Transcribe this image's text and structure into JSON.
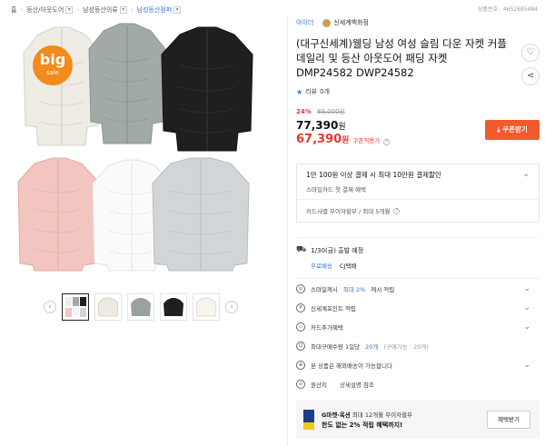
{
  "breadcrumbs": [
    "홈",
    "등산/아웃도어",
    "남성등산의류",
    "남성등산점퍼"
  ],
  "product_code": "상품번호 : 4652695484",
  "badge": {
    "line1": "big",
    "line2": "sale"
  },
  "thumbnail_nav": {
    "prev": "‹",
    "next": "›"
  },
  "shop": {
    "link1": "아이더",
    "link2": "신세계백화점"
  },
  "title": "(대구신세계)웰딩 남성 여성 슬림 다운 자켓 커플 데일리 및 등산 아웃도어 패딩 자켓 DMP24582 DWP24582",
  "review": {
    "icon": "★",
    "label": "리뷰",
    "count": "0개"
  },
  "price": {
    "discount": "24%",
    "original": "89,000원",
    "sale": "77,390",
    "coupon_price": "67,390",
    "currency": "원",
    "coupon_label": "쿠폰적용가",
    "coupon_button": "쿠폰받기"
  },
  "promo": {
    "title": "1만 100원 이상 결제 시 최대 10만원 결제할인",
    "subtitle": "스마일카드 첫 결제 혜택",
    "installment": "카드사별 무이자할부 / 최대 5개월"
  },
  "shipping": {
    "date": "1/30(금) 출발 예정",
    "free": "무료배송",
    "carrier": "CJ택배"
  },
  "options": [
    {
      "icon": "card-icon",
      "glyph": "◎",
      "pre": "스마일캐시",
      "blue": "최대 2%",
      "post": "캐시 적립",
      "chev": "⌄"
    },
    {
      "icon": "points-icon",
      "glyph": "P",
      "pre": "신세계포인트 적립",
      "blue": "",
      "post": "",
      "chev": "⌄"
    },
    {
      "icon": "creditcard-icon",
      "glyph": "▭",
      "pre": "카드추가혜택",
      "blue": "",
      "post": "",
      "chev": "⌄"
    },
    {
      "icon": "bag-icon",
      "glyph": "⊡",
      "pre": "최대구매수량 1일당",
      "blue": "20개",
      "post": "",
      "gray": "(구매가능 : 20개)",
      "chev": ""
    },
    {
      "icon": "globe-icon",
      "glyph": "⊕",
      "pre": "본 상품은 해외배송이 가능합니다",
      "blue": "",
      "post": "",
      "chev": "⌄"
    },
    {
      "icon": "origin-icon",
      "glyph": "⊙",
      "pre": "원산지",
      "blue": "",
      "post": "",
      "link": "상세설명 참조",
      "chev": ""
    }
  ],
  "banner": {
    "brand": "G마켓·옥션",
    "line1_rest": "최대 12개월 무이자할부",
    "line2": "한도 없는 2% 적립 혜택까지!",
    "button": "혜택받기"
  },
  "colors": {
    "accent": "#f15a2b",
    "price_red": "#e43a2a",
    "link_blue": "#3a6fd8",
    "badge_orange": "#f28a1c"
  },
  "thumbnails": [
    "multi",
    "white",
    "gray",
    "black",
    "ivory"
  ]
}
